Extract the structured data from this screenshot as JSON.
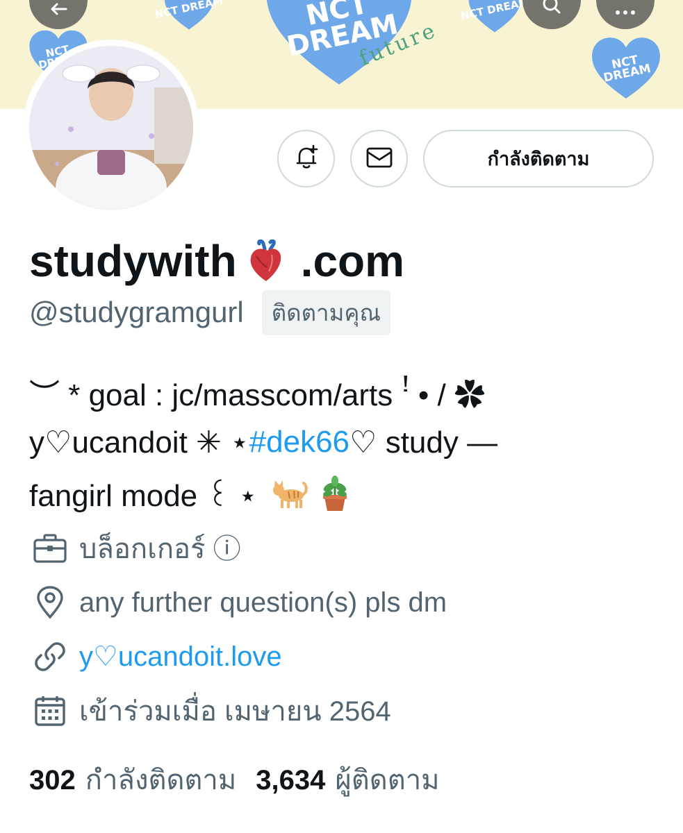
{
  "banner": {
    "heart_texts": [
      "NCT DREAM",
      "NCT DREAM",
      "NCT DREAM",
      "NCT DREAM",
      "NCT DREAM"
    ],
    "future_text": "future",
    "colors": {
      "background": "#f7f3d3",
      "heart": "#6fa8e8",
      "future": "#4aa37a"
    }
  },
  "top_actions": {
    "back_icon": "arrow-left-icon",
    "search_icon": "search-icon",
    "more_icon": "more-horizontal-icon"
  },
  "actions": {
    "notify_icon": "bell-plus-icon",
    "message_icon": "envelope-icon",
    "following_label": "กำลังติดตาม"
  },
  "profile": {
    "display_name_part1": "studywith",
    "display_name_emoji": "anatomical-heart-emoji",
    "display_name_part2": ".com",
    "handle": "@studygramgurl",
    "follows_you": "ติดตามคุณ"
  },
  "bio": {
    "line1": "︶ * goal : jc/masscom/arts ꜝ • / ✿",
    "line2_pre": "y♡ucandoit ✳ ⋆ ",
    "line2_hashtag": "#dek66",
    "line2_post": " ♡ study —",
    "line3": "fangirl mode ꒰ ⋆",
    "line3_emoji": [
      "cat-emoji",
      "potted-plant-emoji"
    ]
  },
  "meta": {
    "category": "บล็อกเกอร์ ⓘ",
    "location": "any further question(s) pls dm",
    "website": "y♡ucandoit.love",
    "joined": "เข้าร่วมเมื่อ เมษายน 2564",
    "icons": [
      "briefcase-icon",
      "location-pin-icon",
      "link-icon",
      "calendar-icon"
    ]
  },
  "stats": {
    "following_count": "302",
    "following_label": "กำลังติดตาม",
    "followers_count": "3,634",
    "followers_label": "ผู้ติดตาม"
  },
  "colors": {
    "text": "#0f1419",
    "secondary": "#536471",
    "link": "#1d9bf0",
    "border": "#cfd9de"
  }
}
